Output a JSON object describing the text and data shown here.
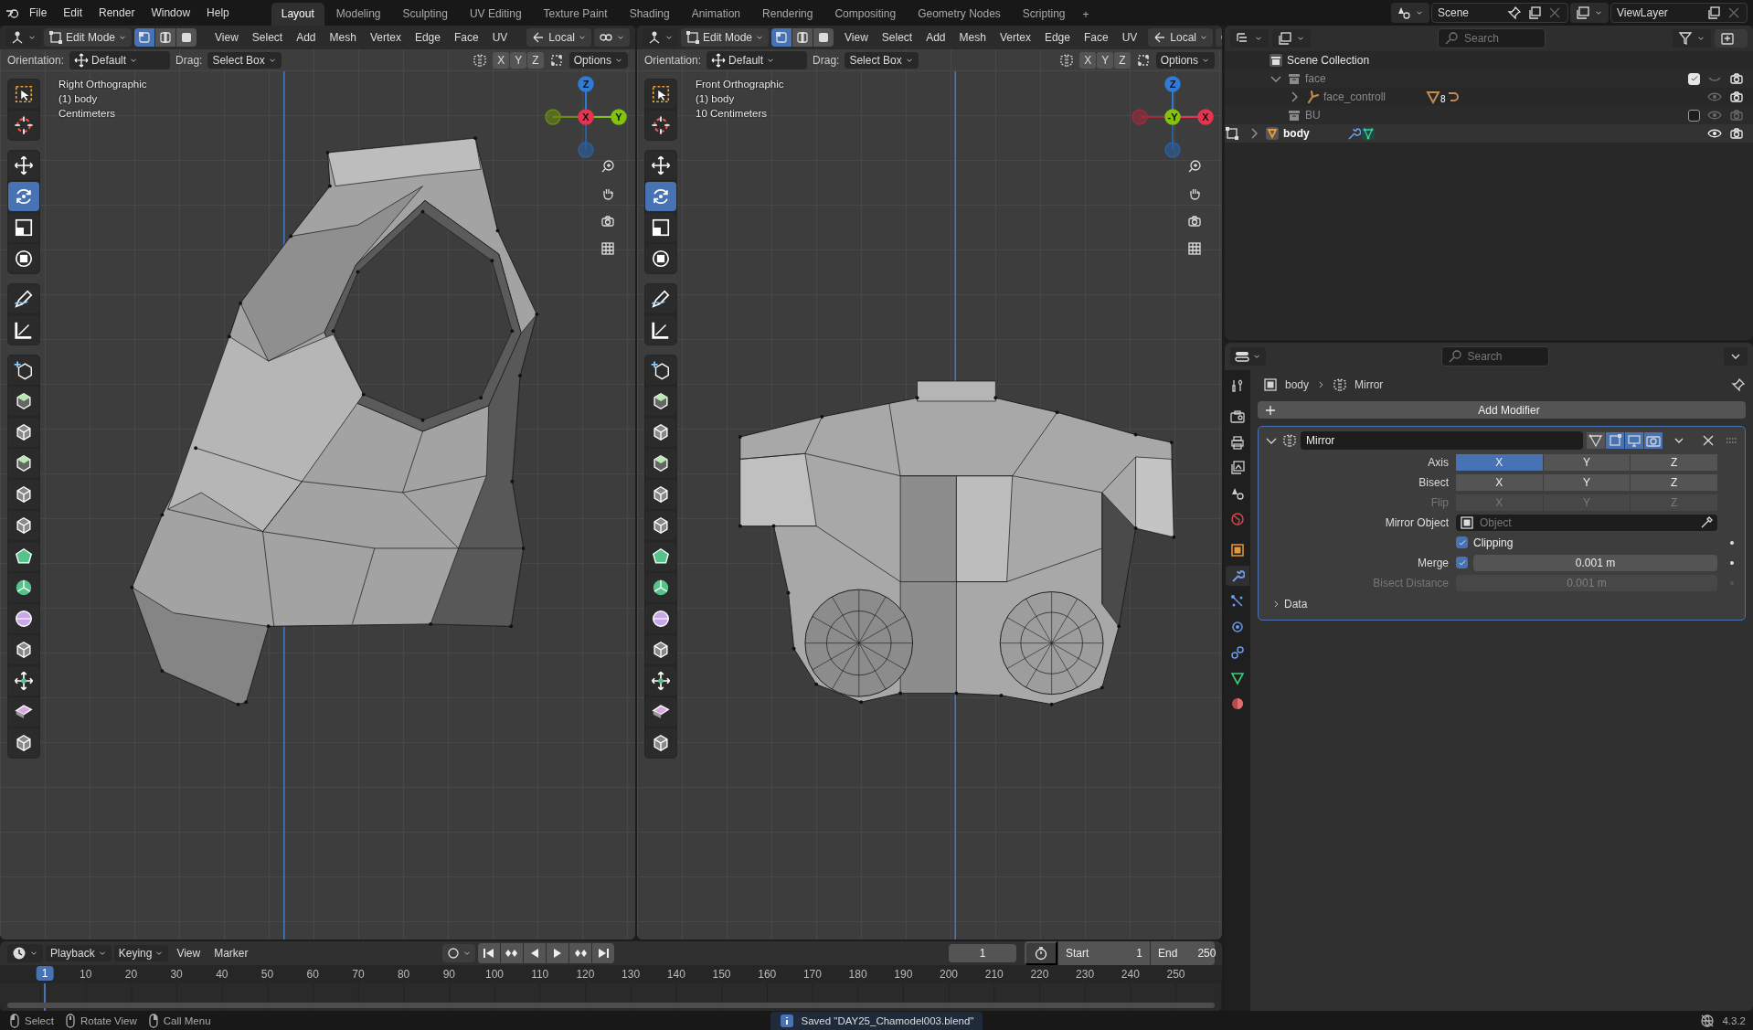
{
  "top_bar": {
    "menus": [
      "File",
      "Edit",
      "Render",
      "Window",
      "Help"
    ],
    "workspaces": [
      {
        "label": "Layout",
        "selected": true
      },
      {
        "label": "Modeling",
        "selected": false
      },
      {
        "label": "Sculpting",
        "selected": false
      },
      {
        "label": "UV Editing",
        "selected": false
      },
      {
        "label": "Texture Paint",
        "selected": false
      },
      {
        "label": "Shading",
        "selected": false
      },
      {
        "label": "Animation",
        "selected": false
      },
      {
        "label": "Rendering",
        "selected": false
      },
      {
        "label": "Compositing",
        "selected": false
      },
      {
        "label": "Geometry Nodes",
        "selected": false
      },
      {
        "label": "Scripting",
        "selected": false
      }
    ],
    "add_workspace": "+",
    "scene": "Scene",
    "view_layer": "ViewLayer"
  },
  "viewports": [
    {
      "mode": "Edit Mode",
      "select_modes": [
        {
          "kind": "vertex",
          "selected": true
        },
        {
          "kind": "edge",
          "selected": false
        },
        {
          "kind": "face",
          "selected": false
        }
      ],
      "menus": [
        "View",
        "Select",
        "Add",
        "Mesh",
        "Vertex",
        "Edge",
        "Face",
        "UV"
      ],
      "orientation_menu": "Local",
      "orientation_label": "Orientation:",
      "orientation": "Default",
      "drag_label": "Drag:",
      "drag": "Select Box",
      "mirror_axes": [
        "X",
        "Y",
        "Z"
      ],
      "options": "Options",
      "overlay": [
        "Right Orthographic",
        "(1) body",
        "Centimeters"
      ],
      "gizmo": [
        {
          "kind": "top",
          "label": "Z",
          "color": "#2f7bd6"
        },
        {
          "kind": "left",
          "color": "#6b8a12"
        },
        {
          "kind": "center",
          "label": "X",
          "color": "#e6334f"
        },
        {
          "kind": "right",
          "label": "Y",
          "color": "#83c20e"
        },
        {
          "kind": "bottom",
          "color": "#2a5f9e"
        }
      ],
      "kind": "side",
      "tool_groups": [
        [
          {
            "kind": "select_box",
            "selected": false
          },
          {
            "kind": "cursor",
            "selected": false
          }
        ],
        [
          {
            "kind": "move",
            "selected": false
          },
          {
            "kind": "rotate",
            "selected": true
          },
          {
            "kind": "scale",
            "selected": false
          },
          {
            "kind": "transform",
            "selected": false
          }
        ],
        [
          {
            "kind": "annotate",
            "selected": false
          },
          {
            "kind": "measure",
            "selected": false
          }
        ],
        [
          {
            "kind": "add_cube",
            "selected": false
          },
          {
            "kind": "extrude",
            "selected": false
          },
          {
            "kind": "inset",
            "selected": false
          },
          {
            "kind": "bevel",
            "selected": false
          },
          {
            "kind": "loop_cut",
            "selected": false
          },
          {
            "kind": "knife",
            "selected": false
          },
          {
            "kind": "poly_build",
            "selected": false
          },
          {
            "kind": "spin",
            "selected": false
          },
          {
            "kind": "smooth",
            "selected": false
          },
          {
            "kind": "edge_slide",
            "selected": false
          },
          {
            "kind": "shrink",
            "selected": false
          },
          {
            "kind": "shear",
            "selected": false
          },
          {
            "kind": "rip",
            "selected": false
          }
        ]
      ]
    },
    {
      "mode": "Edit Mode",
      "select_modes": [
        {
          "kind": "vertex",
          "selected": true
        },
        {
          "kind": "edge",
          "selected": false
        },
        {
          "kind": "face",
          "selected": false
        }
      ],
      "menus": [
        "View",
        "Select",
        "Add",
        "Mesh",
        "Vertex",
        "Edge",
        "Face",
        "UV"
      ],
      "orientation_menu": "Local",
      "orientation_label": "Orientation:",
      "orientation": "Default",
      "drag_label": "Drag:",
      "drag": "Select Box",
      "mirror_axes": [
        "X",
        "Y",
        "Z"
      ],
      "options": "Options",
      "overlay": [
        "Front Orthographic",
        "(1) body",
        "10 Centimeters"
      ],
      "gizmo": [
        {
          "kind": "top",
          "label": "Z",
          "color": "#2f7bd6"
        },
        {
          "kind": "left",
          "color": "#9e2a3c"
        },
        {
          "kind": "center",
          "label": "-Y",
          "color": "#83c20e"
        },
        {
          "kind": "right",
          "label": "X",
          "color": "#e6334f"
        },
        {
          "kind": "bottom",
          "color": "#2a5f9e"
        }
      ],
      "kind": "front",
      "tool_groups": [
        [
          {
            "kind": "select_box",
            "selected": false
          },
          {
            "kind": "cursor",
            "selected": false
          }
        ],
        [
          {
            "kind": "move",
            "selected": false
          },
          {
            "kind": "rotate",
            "selected": true
          },
          {
            "kind": "scale",
            "selected": false
          },
          {
            "kind": "transform",
            "selected": false
          }
        ],
        [
          {
            "kind": "annotate",
            "selected": false
          },
          {
            "kind": "measure",
            "selected": false
          }
        ],
        [
          {
            "kind": "add_cube",
            "selected": false
          },
          {
            "kind": "extrude",
            "selected": false
          },
          {
            "kind": "inset",
            "selected": false
          },
          {
            "kind": "bevel",
            "selected": false
          },
          {
            "kind": "loop_cut",
            "selected": false
          },
          {
            "kind": "knife",
            "selected": false
          },
          {
            "kind": "poly_build",
            "selected": false
          },
          {
            "kind": "spin",
            "selected": false
          },
          {
            "kind": "smooth",
            "selected": false
          },
          {
            "kind": "edge_slide",
            "selected": false
          },
          {
            "kind": "shrink",
            "selected": false
          },
          {
            "kind": "shear",
            "selected": false
          },
          {
            "kind": "rip",
            "selected": false
          }
        ]
      ]
    }
  ],
  "outliner": {
    "search_placeholder": "Search",
    "tree": [
      {
        "kind": "scene",
        "name": "Scene Collection",
        "children": [
          {
            "kind": "collection",
            "name": "face",
            "expanded": true,
            "included": true,
            "hidden": true,
            "dimmed": true,
            "active": false,
            "children": [
              {
                "kind": "armature",
                "name": "face_controll",
                "expanded": false,
                "hidden": false,
                "dimmed": true,
                "active": false,
                "badge": "8"
              }
            ]
          },
          {
            "kind": "collection",
            "name": "BU",
            "included": false,
            "hidden": false,
            "dimmed": true,
            "active": false
          },
          {
            "kind": "mesh",
            "name": "body",
            "expanded": false,
            "hidden": false,
            "dimmed": false,
            "active": true
          }
        ]
      }
    ]
  },
  "properties": {
    "search_placeholder": "Search",
    "tabs": [
      {
        "kind": "tool",
        "selected": false
      },
      {
        "kind": "render",
        "selected": false
      },
      {
        "kind": "output",
        "selected": false
      },
      {
        "kind": "view_layer",
        "selected": false
      },
      {
        "kind": "scene",
        "selected": false
      },
      {
        "kind": "world",
        "selected": false
      },
      {
        "kind": "object",
        "selected": false
      },
      {
        "kind": "modifier",
        "selected": true
      },
      {
        "kind": "particles",
        "selected": false
      },
      {
        "kind": "physics",
        "selected": false
      },
      {
        "kind": "constraints",
        "selected": false
      },
      {
        "kind": "data",
        "selected": false
      },
      {
        "kind": "material",
        "selected": false
      }
    ],
    "breadcrumb": [
      "body",
      "Mirror"
    ],
    "add_modifier": "Add Modifier",
    "modifier": {
      "name": "Mirror",
      "expanded": true,
      "toggles": [
        {
          "kind": "cage",
          "on": false
        },
        {
          "kind": "edit",
          "on": true
        },
        {
          "kind": "viewport",
          "on": true
        },
        {
          "kind": "render",
          "on": true
        }
      ],
      "rows": [
        {
          "kind": "axes",
          "label": "Axis",
          "disabled": false,
          "options": [
            {
              "label": "X",
              "selected": true
            },
            {
              "label": "Y",
              "selected": false
            },
            {
              "label": "Z",
              "selected": false
            }
          ]
        },
        {
          "kind": "axes",
          "label": "Bisect",
          "disabled": false,
          "options": [
            {
              "label": "X",
              "selected": false
            },
            {
              "label": "Y",
              "selected": false
            },
            {
              "label": "Z",
              "selected": false
            }
          ]
        },
        {
          "kind": "axes",
          "label": "Flip",
          "disabled": true,
          "options": [
            {
              "label": "X",
              "selected": false
            },
            {
              "label": "Y",
              "selected": false
            },
            {
              "label": "Z",
              "selected": false
            }
          ]
        },
        {
          "kind": "object",
          "label": "Mirror Object",
          "disabled": false,
          "placeholder": "Object"
        },
        {
          "kind": "check",
          "label": "Clipping",
          "disabled": false,
          "checked": true
        },
        {
          "kind": "check_value",
          "label": "Merge",
          "disabled": false,
          "checked": true,
          "value": "0.001 m"
        },
        {
          "kind": "value",
          "label": "Bisect Distance",
          "disabled": true,
          "value": "0.001 m"
        }
      ],
      "subpanel": {
        "label": "Data",
        "expanded": false
      }
    }
  },
  "timeline": {
    "menus": [
      {
        "label": "Playback",
        "kind": "dropdown"
      },
      {
        "label": "Keying",
        "kind": "dropdown"
      },
      {
        "label": "View",
        "kind": "menu"
      },
      {
        "label": "Marker",
        "kind": "menu"
      }
    ],
    "current_frame": "1",
    "start_label": "Start",
    "start": "1",
    "end_label": "End",
    "end": "250",
    "playhead": "1",
    "ruler": [
      "10",
      "20",
      "30",
      "40",
      "50",
      "60",
      "70",
      "80",
      "90",
      "100",
      "110",
      "120",
      "130",
      "140",
      "150",
      "160",
      "170",
      "180",
      "190",
      "200",
      "210",
      "220",
      "230",
      "240",
      "250"
    ]
  },
  "status_bar": {
    "hints": [
      {
        "kind": "left",
        "label": "Select"
      },
      {
        "kind": "middle",
        "label": "Rotate View"
      },
      {
        "kind": "right",
        "label": "Call Menu"
      }
    ],
    "message": "Saved \"DAY25_Chamodel003.blend\"",
    "version": "4.3.2"
  }
}
